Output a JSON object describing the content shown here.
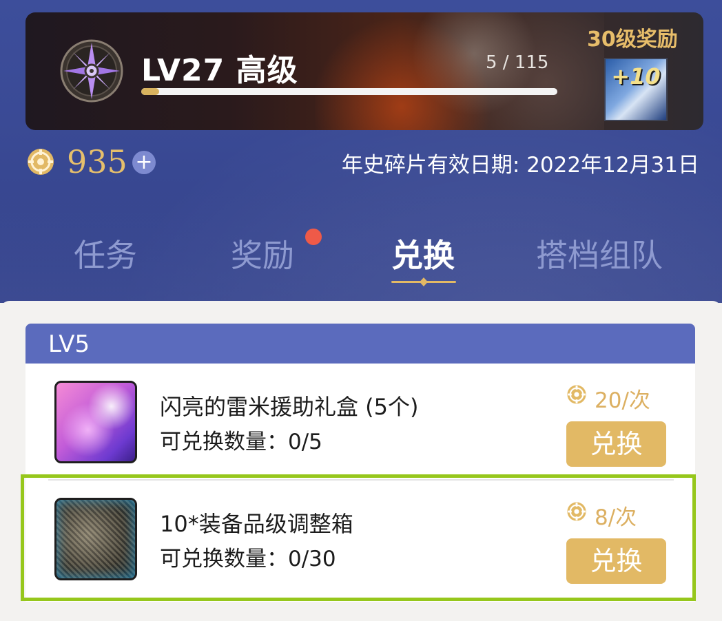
{
  "level": {
    "title": "LV27 高级",
    "progress_text": "5 / 115",
    "progress_fraction": 0.043,
    "reward_label": "30级奖励",
    "reward_item_text": "+10"
  },
  "currency": {
    "amount": "935",
    "plus_label": "+",
    "expiry": "年史碎片有效日期: 2022年12月31日"
  },
  "tabs": [
    {
      "label": "任务",
      "active": false,
      "has_badge": false
    },
    {
      "label": "奖励",
      "active": false,
      "has_badge": true
    },
    {
      "label": "兑换",
      "active": true,
      "has_badge": false
    },
    {
      "label": "搭档组队",
      "active": false,
      "has_badge": false
    }
  ],
  "section": {
    "title": "LV5",
    "items": [
      {
        "name": "闪亮的雷米援助礼盒 (5个)",
        "qty": "可兑换数量：0/5",
        "price": "20/次",
        "button": "兑换"
      },
      {
        "name": "10*装备品级调整箱",
        "qty": "可兑换数量：0/30",
        "price": "8/次",
        "button": "兑换"
      }
    ]
  },
  "colors": {
    "accent_gold": "#e2b965",
    "header_blue": "#5b6bbd",
    "badge_red": "#ef5a48",
    "highlight_green": "#96c71c"
  }
}
